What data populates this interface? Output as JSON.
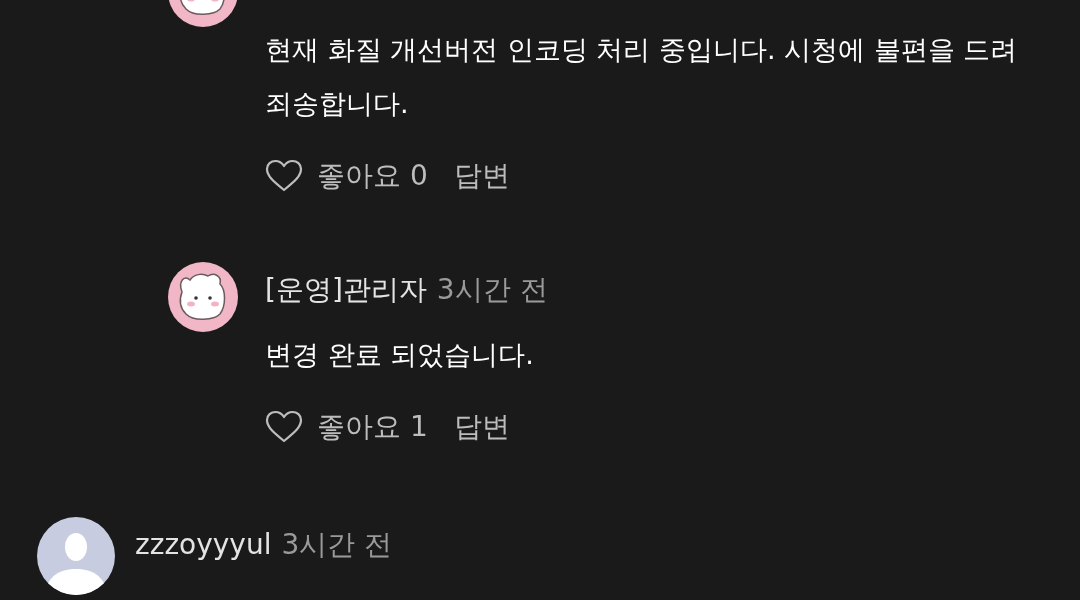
{
  "comments": [
    {
      "kind": "reply",
      "avatar": {
        "kind": "bunny"
      },
      "body": "현재 화질 개선버전 인코딩 처리 중입니다. 시청에 불편을 드려 죄송합니다.",
      "like_label": "좋아요 0",
      "reply_label": "답변"
    },
    {
      "kind": "reply",
      "avatar": {
        "kind": "bunny"
      },
      "author": "[운영]관리자",
      "time": "3시간 전",
      "body": "변경 완료 되었습니다.",
      "like_label": "좋아요 1",
      "reply_label": "답변"
    },
    {
      "kind": "comment",
      "avatar": {
        "kind": "default"
      },
      "author": "zzzoyyyul",
      "time": "3시간 전"
    }
  ]
}
